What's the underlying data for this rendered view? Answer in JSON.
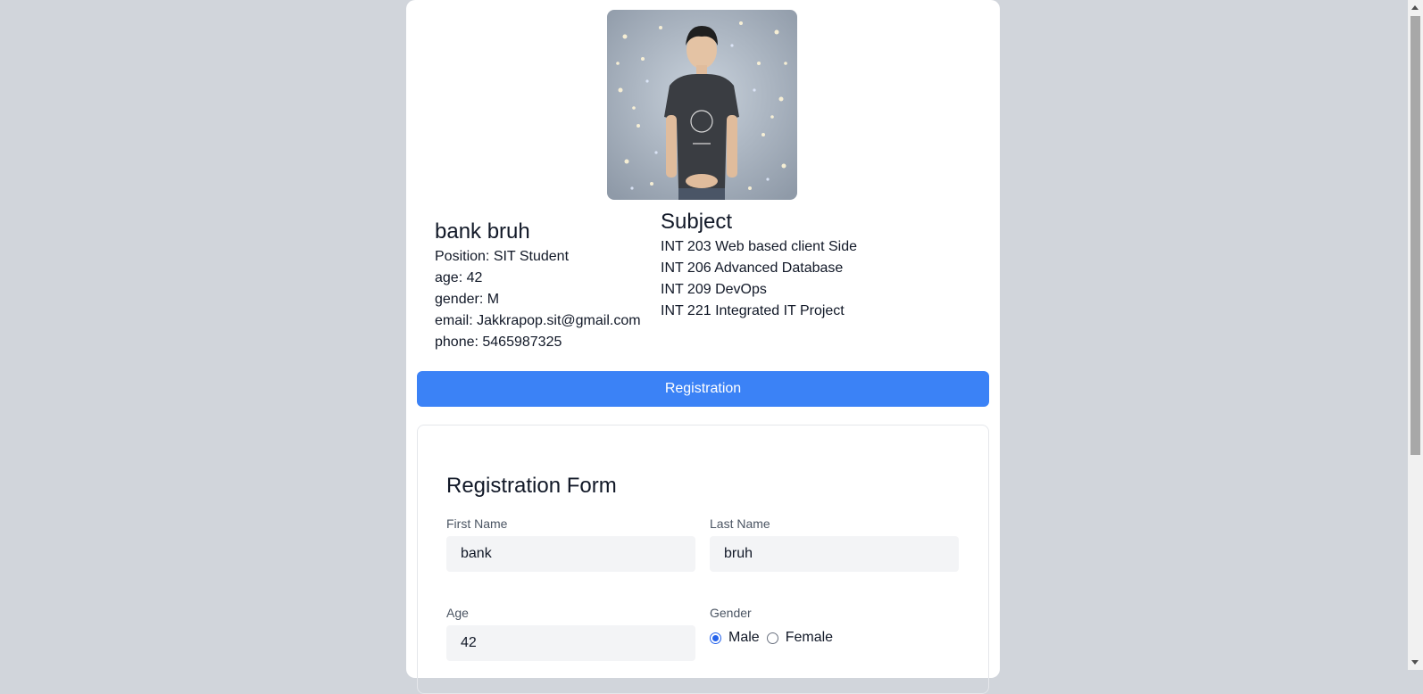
{
  "profile": {
    "photo_icon": "profile-photo",
    "name": "bank bruh",
    "position": "Position: SIT Student",
    "age": "age: 42",
    "gender": "gender: M",
    "email": "email: Jakkrapop.sit@gmail.com",
    "phone": "phone: 5465987325"
  },
  "subjects": {
    "title": "Subject",
    "items": [
      "INT 203 Web based client Side",
      "INT 206 Advanced Database",
      "INT 209 DevOps",
      "INT 221 Integrated IT Project"
    ]
  },
  "registration_button": "Registration",
  "form": {
    "title": "Registration Form",
    "first_name_label": "First Name",
    "first_name_value": "bank",
    "last_name_label": "Last Name",
    "last_name_value": "bruh",
    "age_label": "Age",
    "age_value": "42",
    "gender_label": "Gender",
    "gender_options": [
      "Male",
      "Female"
    ],
    "gender_selected": "Male"
  },
  "colors": {
    "accent": "#3b82f6",
    "page_bg": "#d1d5db",
    "input_bg": "#f3f4f6"
  }
}
